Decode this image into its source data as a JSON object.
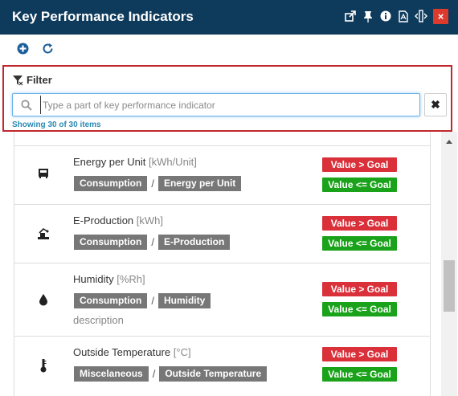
{
  "window": {
    "title": "Key Performance Indicators",
    "icons": [
      "popout-icon",
      "pin-icon",
      "info-icon",
      "pdf-icon",
      "resize-icon"
    ],
    "close_label": "×"
  },
  "toolbar": {
    "buttons": [
      "add-icon",
      "refresh-icon"
    ]
  },
  "filter": {
    "label": "Filter",
    "placeholder": "Type a part of key performance indicator",
    "value": "",
    "clear_label": "✖",
    "count_text": "Showing 30 of 30 items"
  },
  "kpis": [
    {
      "name": "Energy per Unit",
      "unit": "[kWh/Unit]",
      "icon": "meter-icon",
      "category": "Consumption",
      "kpi_tag": "Energy per Unit",
      "description": "",
      "badge_over": "Value > Goal",
      "badge_under": "Value <= Goal"
    },
    {
      "name": "E-Production",
      "unit": "[kWh]",
      "icon": "production-icon",
      "category": "Consumption",
      "kpi_tag": "E-Production",
      "description": "",
      "badge_over": "Value > Goal",
      "badge_under": "Value <= Goal"
    },
    {
      "name": "Humidity",
      "unit": "[%Rh]",
      "icon": "drop-icon",
      "category": "Consumption",
      "kpi_tag": "Humidity",
      "description": "description",
      "badge_over": "Value > Goal",
      "badge_under": "Value <= Goal"
    },
    {
      "name": "Outside Temperature",
      "unit": "[°C]",
      "icon": "thermometer-icon",
      "category": "Miscelaneous",
      "kpi_tag": "Outside Temperature",
      "description": "",
      "badge_over": "Value > Goal",
      "badge_under": "Value <= Goal"
    }
  ],
  "colors": {
    "titlebar": "#0e3a5c",
    "filter_border": "#c0282d",
    "badge_over": "#d9303a",
    "badge_under": "#1aa31a",
    "tag": "#777777",
    "count_text": "#2a8ab3"
  }
}
